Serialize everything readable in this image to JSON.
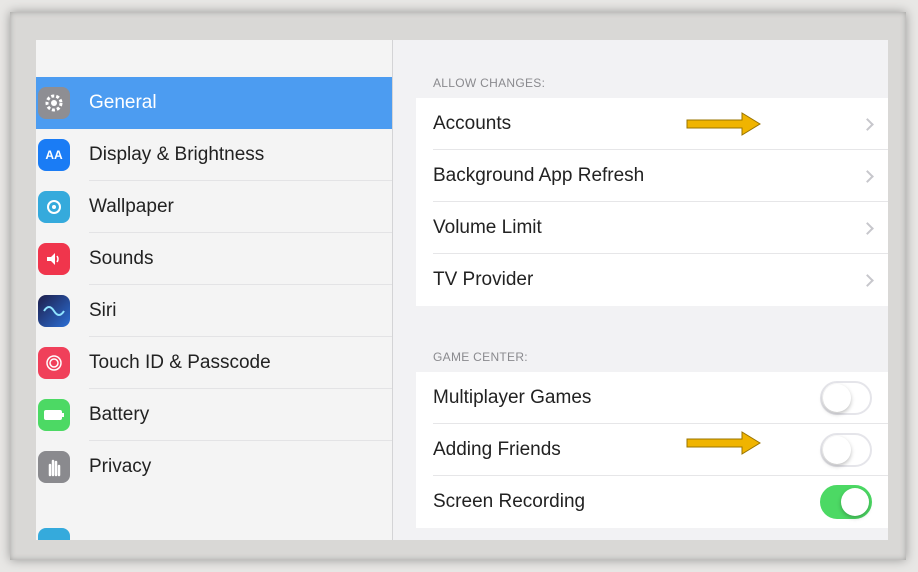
{
  "sidebar": {
    "items": [
      {
        "label": "General",
        "icon": "gear-icon",
        "color": "#8e8e93",
        "selected": true
      },
      {
        "label": "Display & Brightness",
        "icon": "display-brightness-icon",
        "color": "#1a7cf5"
      },
      {
        "label": "Wallpaper",
        "icon": "wallpaper-icon",
        "color": "#35aadc"
      },
      {
        "label": "Sounds",
        "icon": "speaker-icon",
        "color": "#f0354c"
      },
      {
        "label": "Siri",
        "icon": "siri-icon",
        "color": "#2b2d6e"
      },
      {
        "label": "Touch ID & Passcode",
        "icon": "fingerprint-icon",
        "color": "#f0405a"
      },
      {
        "label": "Battery",
        "icon": "battery-icon",
        "color": "#4cd964"
      },
      {
        "label": "Privacy",
        "icon": "hand-icon",
        "color": "#8a8a8e"
      }
    ],
    "selected_color": "#4c9cf1"
  },
  "content": {
    "allow_changes": {
      "header": "ALLOW CHANGES:",
      "rows": [
        {
          "label": "Accounts"
        },
        {
          "label": "Background App Refresh"
        },
        {
          "label": "Volume Limit"
        },
        {
          "label": "TV Provider"
        }
      ]
    },
    "game_center": {
      "header": "GAME CENTER:",
      "rows": [
        {
          "label": "Multiplayer Games",
          "toggle": false
        },
        {
          "label": "Adding Friends",
          "toggle": false
        },
        {
          "label": "Screen Recording",
          "toggle": true
        }
      ]
    }
  },
  "annotations": {
    "arrow_color": "#f0b400"
  }
}
